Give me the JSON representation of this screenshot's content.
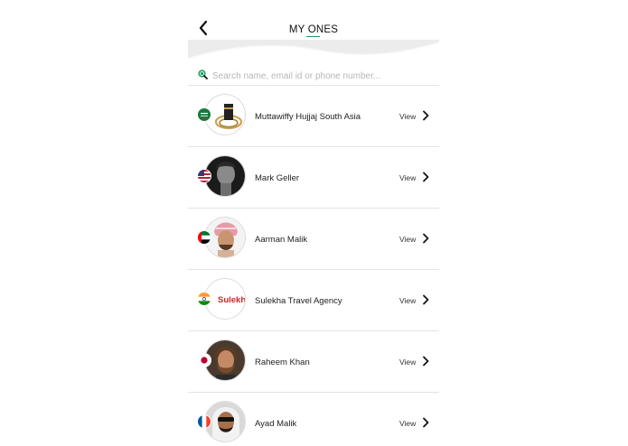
{
  "header": {
    "title_pre": "MY ",
    "title_under": "ON",
    "title_post": "ES"
  },
  "search": {
    "placeholder": "Search name, email id or phone number..."
  },
  "colors": {
    "accent_green": "#1f9e5b",
    "divider": "#e3e3e3"
  },
  "icons": {
    "back": "chevron-left-icon",
    "search": "search-icon",
    "row_action": "chevron-right-icon"
  },
  "contacts": [
    {
      "name": "Muttawiffy Hujjaj South Asia",
      "action": "View",
      "flag": "saudi-arabia"
    },
    {
      "name": "Mark Geller",
      "action": "View",
      "flag": "united-states"
    },
    {
      "name": "Aarman Malik",
      "action": "View",
      "flag": "united-arab-emirates"
    },
    {
      "name": "Sulekha Travel Agency",
      "action": "View",
      "flag": "india",
      "logo_text": "Sulekha"
    },
    {
      "name": "Raheem Khan",
      "action": "View",
      "flag": "japan"
    },
    {
      "name": "Ayad Malik",
      "action": "View",
      "flag": "france"
    }
  ]
}
